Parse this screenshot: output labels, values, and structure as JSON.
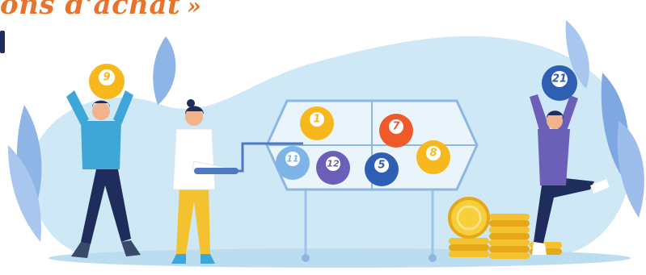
{
  "headline": {
    "text": "ons d'achat",
    "arrow": "»"
  },
  "balls": {
    "held_left": "9",
    "held_right": "21",
    "drum_1": "1",
    "drum_7": "7",
    "drum_11": "11",
    "drum_12": "12",
    "drum_5": "5",
    "drum_8": "8"
  },
  "colors": {
    "accent": "#e8742c",
    "blob": "#cfe8f6",
    "navy": "#1f2d5c",
    "yellow_ball": "#f6b81c",
    "orange_ball": "#ef5a2a",
    "blue_ball": "#2f5fb3",
    "gold": "#f3c22e"
  }
}
